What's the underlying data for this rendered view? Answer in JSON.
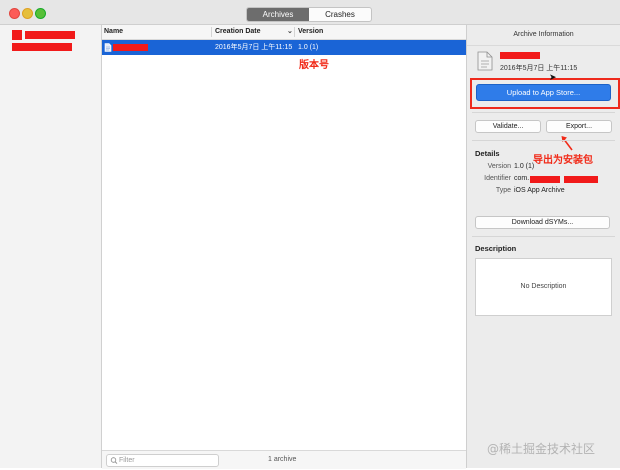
{
  "toolbar": {
    "tabs": [
      {
        "label": "Archives",
        "selected": true
      },
      {
        "label": "Crashes",
        "selected": false
      }
    ]
  },
  "table": {
    "columns": [
      "Name",
      "Creation Date",
      "Version"
    ],
    "rows": [
      {
        "date": "2016年5月7日 上午11:15",
        "version": "1.0 (1)"
      }
    ]
  },
  "footer": {
    "filter_placeholder": "Filter",
    "count": "1 archive"
  },
  "annotations": {
    "version_note": "版本号",
    "export_note": "导出为安装包"
  },
  "inspector": {
    "title": "Archive Information",
    "archive_date": "2016年5月7日 上午11:15",
    "upload_label": "Upload to App Store...",
    "validate_label": "Validate...",
    "export_label": "Export...",
    "details_heading": "Details",
    "details": {
      "version_label": "Version",
      "version_value": "1.0 (1)",
      "identifier_label": "Identifier",
      "identifier_value": "com.",
      "type_label": "Type",
      "type_value": "iOS App Archive"
    },
    "download_dsyms_label": "Download dSYMs...",
    "description_heading": "Description",
    "description_placeholder": "No Description"
  },
  "watermark": "@稀土掘金技术社区",
  "colors": {
    "selection": "#1a64d6",
    "upload_button": "#2f7ce9",
    "annotation_red": "#f12a18",
    "redaction": "#f11a1a"
  },
  "icons": [
    "archive-file-icon",
    "search-icon",
    "sort-chevron-down-icon",
    "arrow-icon"
  ]
}
